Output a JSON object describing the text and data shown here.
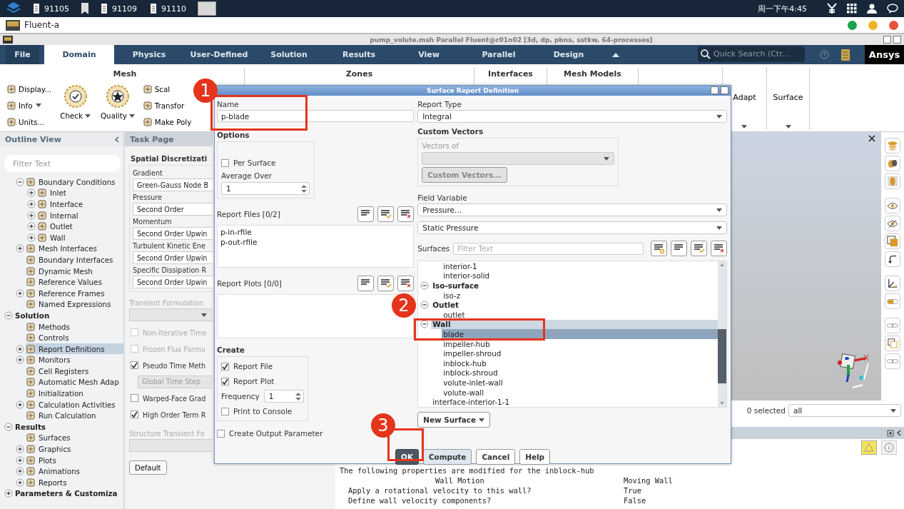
{
  "taskbar": {
    "items": [
      {
        "kind": "window",
        "label": "91105"
      },
      {
        "kind": "bookmark"
      },
      {
        "kind": "window",
        "label": "91109"
      },
      {
        "kind": "window",
        "label": "91110"
      },
      {
        "kind": "app"
      }
    ],
    "clock": "周一下午4:45"
  },
  "app_window": {
    "title": "Fluent-a"
  },
  "fluent_title": "pump_volute.msh Parallel Fluent@c01n02  [3d, dp, pbns, sstkw, 64-processes]",
  "ribbon": {
    "tabs": [
      {
        "label": "File",
        "kind": "file",
        "selected": false
      },
      {
        "label": "Domain",
        "kind": "tab",
        "selected": true
      },
      {
        "label": "Physics",
        "kind": "tab",
        "selected": false
      },
      {
        "label": "User-Defined",
        "kind": "tab",
        "selected": false
      },
      {
        "label": "Solution",
        "kind": "tab",
        "selected": false
      },
      {
        "label": "Results",
        "kind": "tab",
        "selected": false
      },
      {
        "label": "View",
        "kind": "tab",
        "selected": false
      },
      {
        "label": "Parallel",
        "kind": "tab",
        "selected": false
      },
      {
        "label": "Design",
        "kind": "tab",
        "selected": false
      }
    ],
    "search_placeholder": "Quick Search (Ctr...",
    "brand": "Ansys",
    "groups": [
      {
        "kind": "mesh",
        "title": "Mesh",
        "small_left": [
          "Display...",
          "Info",
          "Units..."
        ],
        "large": [
          "Check",
          "Quality"
        ],
        "small_right": [
          "Scal",
          "Transfor",
          "Make Poly"
        ]
      },
      {
        "kind": "titled",
        "title": "Zones"
      },
      {
        "kind": "titled",
        "title": "Interfaces"
      },
      {
        "kind": "titled",
        "title": "Mesh Models"
      },
      {
        "kind": "blank"
      },
      {
        "kind": "collapsed",
        "title": "Adapt"
      },
      {
        "kind": "collapsed",
        "title": "Surface"
      }
    ]
  },
  "outline": {
    "title": "Outline View",
    "filter_placeholder": "Filter Text",
    "tree": [
      {
        "kind": "continued",
        "children": [
          {
            "kind": "branch",
            "label": "Boundary Conditions",
            "expanded": true,
            "selected": false,
            "children": [
              {
                "kind": "branch",
                "label": "Inlet",
                "expanded": false,
                "selected": false
              },
              {
                "kind": "branch",
                "label": "Interface",
                "expanded": false,
                "selected": false
              },
              {
                "kind": "branch",
                "label": "Internal",
                "expanded": false,
                "selected": false
              },
              {
                "kind": "branch",
                "label": "Outlet",
                "expanded": false,
                "selected": false
              },
              {
                "kind": "branch",
                "label": "Wall",
                "expanded": false,
                "selected": false
              }
            ]
          },
          {
            "kind": "branch",
            "label": "Mesh Interfaces",
            "expanded": false,
            "selected": false
          },
          {
            "kind": "leaf",
            "label": "Boundary Interfaces",
            "selected": false
          },
          {
            "kind": "leaf",
            "label": "Dynamic Mesh",
            "selected": false
          },
          {
            "kind": "leaf",
            "label": "Reference Values",
            "selected": false
          },
          {
            "kind": "branch",
            "label": "Reference Frames",
            "expanded": false,
            "selected": false
          },
          {
            "kind": "leaf",
            "label": "Named Expressions",
            "selected": false
          }
        ]
      },
      {
        "kind": "branch",
        "label": "Solution",
        "expanded": true,
        "selected": false,
        "children": [
          {
            "kind": "leaf",
            "label": "Methods",
            "selected": false
          },
          {
            "kind": "leaf",
            "label": "Controls",
            "selected": false
          },
          {
            "kind": "branch",
            "label": "Report Definitions",
            "expanded": false,
            "selected": true
          },
          {
            "kind": "branch",
            "label": "Monitors",
            "expanded": false,
            "selected": false
          },
          {
            "kind": "leaf",
            "label": "Cell Registers",
            "selected": false
          },
          {
            "kind": "leaf",
            "label": "Automatic Mesh Adap",
            "selected": false
          },
          {
            "kind": "leaf",
            "label": "Initialization",
            "selected": false
          },
          {
            "kind": "branch",
            "label": "Calculation Activities",
            "expanded": false,
            "selected": false
          },
          {
            "kind": "leaf",
            "label": "Run Calculation",
            "selected": false
          }
        ]
      },
      {
        "kind": "branch",
        "label": "Results",
        "expanded": true,
        "selected": false,
        "children": [
          {
            "kind": "leaf",
            "label": "Surfaces",
            "selected": false
          },
          {
            "kind": "branch",
            "label": "Graphics",
            "expanded": false,
            "selected": false
          },
          {
            "kind": "branch",
            "label": "Plots",
            "expanded": false,
            "selected": false
          },
          {
            "kind": "branch",
            "label": "Animations",
            "expanded": false,
            "selected": false
          },
          {
            "kind": "branch",
            "label": "Reports",
            "expanded": false,
            "selected": false
          }
        ]
      },
      {
        "kind": "branch",
        "label": "Parameters & Customiza",
        "expanded": false,
        "selected": false
      }
    ]
  },
  "task_page": {
    "title": "Task Page",
    "section": "Spatial Discretizati",
    "fields": [
      {
        "label": "Gradient",
        "value": "Green-Gauss Node B"
      },
      {
        "label": "Pressure",
        "value": "Second Order"
      },
      {
        "label": "Momentum",
        "value": "Second Order Upwin"
      },
      {
        "label": "Turbulent Kinetic Ene",
        "value": "Second Order Upwin"
      },
      {
        "label": "Specific Dissipation R",
        "value": "Second Order Upwin"
      }
    ],
    "transient_label": "Transient Formulation",
    "options": [
      {
        "kind": "checkbox",
        "label": "Non-Iterative Time",
        "checked": false,
        "disabled": true
      },
      {
        "kind": "checkbox",
        "label": "Frozen Flux Formu",
        "checked": false,
        "disabled": true
      },
      {
        "kind": "checkbox",
        "label": "Pseudo Time Meth",
        "checked": true,
        "disabled": false
      },
      {
        "kind": "dropdown",
        "label": "Global Time Step",
        "disabled": true
      },
      {
        "kind": "checkbox",
        "label": "Warped-Face Grad",
        "checked": false,
        "disabled": false
      },
      {
        "kind": "checkbox",
        "label": "High Order Term R",
        "checked": true,
        "disabled": false
      }
    ],
    "structure_label": "Structure Transient Fo",
    "default_button": "Default"
  },
  "graphics": {
    "selection_count": "0 selected",
    "selection_filter": "all"
  },
  "console": {
    "lines": [
      {
        "kind": "text",
        "text": "The following properties are modified for the inblock-hub"
      },
      {
        "kind": "heading_pair",
        "key": "Wall Motion",
        "value": "Moving Wall"
      },
      {
        "kind": "pair",
        "key": "Apply a rotational velocity to this wall?",
        "value": "True"
      },
      {
        "kind": "pair",
        "key": "Define wall velocity components?",
        "value": "False"
      }
    ]
  },
  "dialog": {
    "title": "Surface Report Definition",
    "name": {
      "label": "Name",
      "value": "p-blade"
    },
    "options": {
      "title": "Options",
      "per_surface": {
        "label": "Per Surface",
        "checked": false
      },
      "average_over": {
        "label": "Average Over",
        "value": "1"
      }
    },
    "report_files": {
      "label": "Report Files  [0/2]",
      "items": [
        {
          "label": "p-in-rfile",
          "selected": false
        },
        {
          "label": "p-out-rfile",
          "selected": false
        }
      ]
    },
    "report_plots": {
      "label": "Report Plots  [0/0]"
    },
    "create": {
      "title": "Create",
      "report_file": {
        "label": "Report File",
        "checked": true
      },
      "report_plot": {
        "label": "Report Plot",
        "checked": true
      },
      "frequency": {
        "label": "Frequency",
        "value": "1"
      },
      "print_to_console": {
        "label": "Print to Console",
        "checked": false
      }
    },
    "create_output_parameter": {
      "label": "Create Output Parameter",
      "checked": false
    },
    "report_type": {
      "label": "Report Type",
      "value": "Integral"
    },
    "custom_vectors": {
      "title": "Custom Vectors",
      "vectors_of_label": "Vectors of",
      "button": "Custom Vectors..."
    },
    "field_variable": {
      "label": "Field Variable",
      "category": "Pressure...",
      "value": "Static Pressure"
    },
    "surfaces": {
      "label": "Surfaces",
      "filter_placeholder": "Filter Text",
      "tree": [
        {
          "kind": "continued",
          "children": [
            {
              "label": "interior-1",
              "selected": false
            },
            {
              "label": "interior-solid",
              "selected": false
            }
          ]
        },
        {
          "kind": "group",
          "label": "Iso-surface",
          "expanded": true,
          "selected": false,
          "children": [
            {
              "label": "iso-z",
              "selected": false
            }
          ]
        },
        {
          "kind": "group",
          "label": "Outlet",
          "expanded": true,
          "selected": false,
          "children": [
            {
              "label": "outlet",
              "selected": false
            }
          ]
        },
        {
          "kind": "group",
          "label": "Wall",
          "expanded": true,
          "selected": true,
          "children": [
            {
              "label": "blade",
              "selected": true
            },
            {
              "label": "impeller-hub",
              "selected": false
            },
            {
              "label": "impeller-shroud",
              "selected": false
            },
            {
              "label": "inblock-hub",
              "selected": false
            },
            {
              "label": "inblock-shroud",
              "selected": false
            },
            {
              "label": "volute-inlet-wall",
              "selected": false
            },
            {
              "label": "volute-wall",
              "selected": false
            }
          ]
        },
        {
          "kind": "item",
          "label": "interface-interior-1-1",
          "selected": false
        }
      ]
    },
    "new_surface": "New Surface",
    "buttons": [
      {
        "label": "OK",
        "kind": "default"
      },
      {
        "label": "Compute",
        "kind": "hover"
      },
      {
        "label": "Cancel",
        "kind": "normal"
      },
      {
        "label": "Help",
        "kind": "normal"
      }
    ]
  },
  "annotations": [
    {
      "number": "1"
    },
    {
      "number": "2"
    },
    {
      "number": "3"
    }
  ]
}
